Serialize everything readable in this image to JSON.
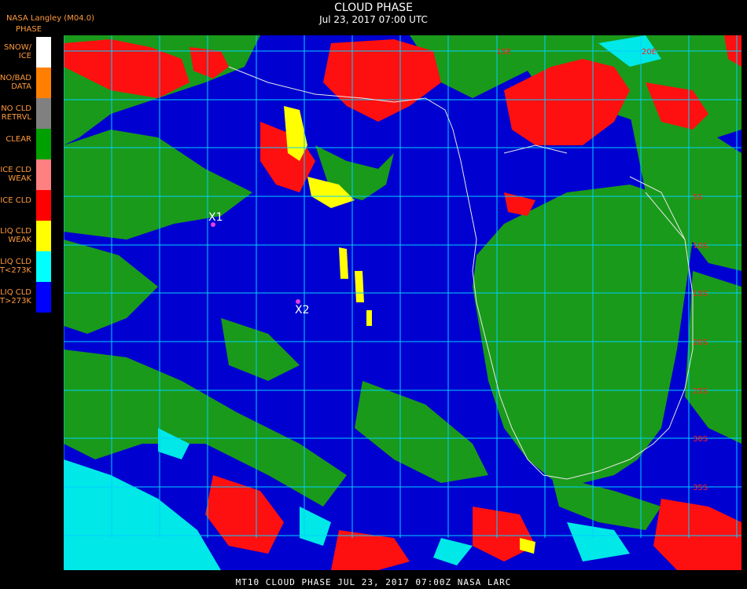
{
  "header": {
    "title": "CLOUD PHASE",
    "subtitle": "Jul 23, 2017 07:00 UTC",
    "org": "NASA Langley (M04.0)"
  },
  "legend": {
    "title": "PHASE",
    "items": [
      {
        "label": "SNOW/\nICE",
        "color": "#ffffff"
      },
      {
        "label": "NO/BAD\nDATA",
        "color": "#ff7f00"
      },
      {
        "label": "NO CLD\nRETRVL",
        "color": "#808080"
      },
      {
        "label": "CLEAR",
        "color": "#00a000"
      },
      {
        "label": "ICE CLD\nWEAK",
        "color": "#ff8080"
      },
      {
        "label": "ICE CLD",
        "color": "#ff0000"
      },
      {
        "label": "LIQ CLD\nWEAK",
        "color": "#ffff00"
      },
      {
        "label": "LIQ CLD\nT<273K",
        "color": "#00ffff"
      },
      {
        "label": "LIQ CLD\nT>273K",
        "color": "#0000ff"
      }
    ]
  },
  "map": {
    "markers": [
      {
        "label": "X1"
      },
      {
        "label": "X2"
      }
    ],
    "grid_labels": [
      "15E",
      "20E",
      "5S",
      "10S",
      "15S",
      "20S",
      "25S",
      "30S",
      "35S"
    ],
    "colors": {
      "ocean_liquid": "#0000d0",
      "land_clear": "#1a9a1a",
      "ice": "#ff1010",
      "liq_cold": "#00e8e8",
      "liq_weak": "#ffff00",
      "grid": "#00d0ff",
      "coast": "#e8e8e8"
    }
  },
  "footer": {
    "text": "MT10  CLOUD PHASE  JUL 23, 2017 07:00Z  NASA LARC"
  }
}
